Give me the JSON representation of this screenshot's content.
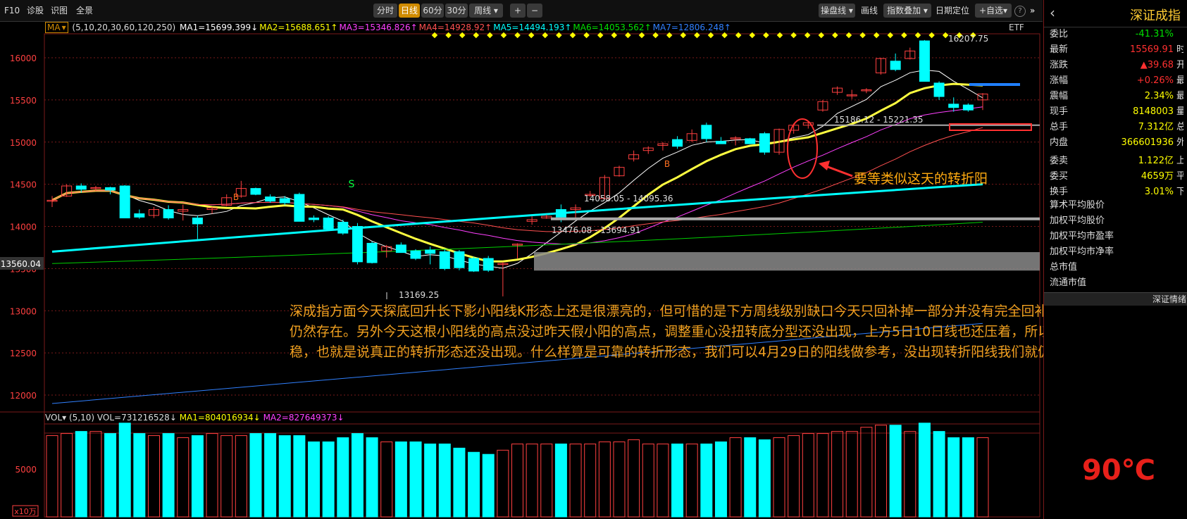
{
  "toolbar": {
    "left_items": [
      "F10",
      "诊股",
      "识图",
      "全景"
    ],
    "period_buttons": [
      "分时",
      "日线",
      "60分",
      "30分",
      "周线"
    ],
    "active_period": "日线",
    "zoom_plus": "+",
    "zoom_minus": "−",
    "right_items": [
      "操盘线",
      "画线",
      "指数叠加",
      "日期定位",
      "自选"
    ],
    "help": "?"
  },
  "ma_line": {
    "label": "MA",
    "params": "(5,10,20,30,60,120,250)",
    "items": [
      {
        "text": "MA1=15699.399↓",
        "color": "#ffffff"
      },
      {
        "text": "MA2=15688.651↑",
        "color": "#ffff00"
      },
      {
        "text": "MA3=15346.826↑",
        "color": "#ff40ff"
      },
      {
        "text": "MA4=14928.92↑",
        "color": "#ff5050"
      },
      {
        "text": "MA5=14494.193↑",
        "color": "#00ffff"
      },
      {
        "text": "MA6=14053.562↑",
        "color": "#00e000"
      },
      {
        "text": "MA7=12806.248↑",
        "color": "#3080ff"
      }
    ],
    "etf": "ETF"
  },
  "y_axis": {
    "ticks": [
      "16000",
      "15500",
      "15000",
      "14500",
      "14000",
      "13500",
      "13000",
      "12500",
      "12000"
    ],
    "current_price_tag": "13560.04"
  },
  "chart_labels": {
    "high": "16207.75",
    "low": "13169.25",
    "gap_top": "15186.12 - 15221.35",
    "gap_mid": "14058.05 - 14095.36",
    "gap_low": "13476.08 - 13694.91",
    "buy_marks": [
      "B",
      "B"
    ],
    "sell_mark": "S"
  },
  "volume": {
    "header_label": "VOL",
    "params": "(5,10)",
    "vol": "VOL=731216528↓",
    "ma1": "MA1=804016934↓",
    "ma2": "MA2=827649373↓",
    "axis_tick": "5000",
    "unit": "x10万"
  },
  "annotation": "要等类似这天的转折阳",
  "note": "深成指方面今天探底回升长下影小阳线K形态上还是很漂亮的，但可惜的是下方周线级别缺口今天只回补掉一部分并没有完全回补，所以缺口技术隐患仍然存在。另外今天这根小阳线的高点没过昨天假小阳的高点，调整重心没扭转底分型还没出现，上方5日10日线也还压着，所以这里仍然不能断定企稳，也就是说真正的转折形态还没出现。什么样算是可靠的转折形态，我们可以4月29日的阳线做参考，没出现转折阳线我们就仍然要多一份谨慎。",
  "panel": {
    "title": "深证成指",
    "rows": [
      {
        "label": "委比",
        "value": "-41.31%",
        "color": "#00e000",
        "cut": ""
      },
      {
        "label": "最新",
        "value": "15569.91",
        "color": "#ff3030",
        "cut": "时"
      },
      {
        "label": "涨跌",
        "value": "▲39.68",
        "color": "#ff3030",
        "cut": "开"
      },
      {
        "label": "涨幅",
        "value": "+0.26%",
        "color": "#ff3030",
        "cut": "最"
      },
      {
        "label": "震幅",
        "value": "2.34%",
        "color": "#ffff00",
        "cut": "最"
      },
      {
        "label": "现手",
        "value": "8148003",
        "color": "#ffff00",
        "cut": "量"
      },
      {
        "label": "总手",
        "value": "7.312亿",
        "color": "#ffff00",
        "cut": "总"
      },
      {
        "label": "内盘",
        "value": "366601936",
        "color": "#ffff00",
        "cut": "外"
      },
      {
        "label": "委卖",
        "value": "1.122亿",
        "color": "#ffff00",
        "cut": "上"
      },
      {
        "label": "委买",
        "value": "4659万",
        "color": "#ffff00",
        "cut": "平"
      },
      {
        "label": "换手",
        "value": "3.01%",
        "color": "#ffff00",
        "cut": "下"
      }
    ],
    "list": [
      "算术平均股价",
      "加权平均股价",
      "加权平均市盈率",
      "加权平均市净率",
      "总市值",
      "流通市值"
    ],
    "bottom_tab": "深证情绪",
    "temperature": "90℃"
  },
  "colors": {
    "up": "#ff4040",
    "down": "#00ffff",
    "grid": "#7a1a1a",
    "accent": "#d08b00"
  }
}
